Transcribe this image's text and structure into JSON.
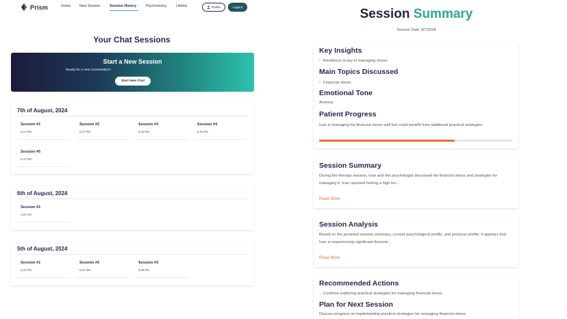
{
  "nav": {
    "brand": "Prism",
    "links": [
      "Home",
      "New Session",
      "Session History",
      "Psychometry",
      "Lifeline"
    ],
    "profile_label": "Profile",
    "logout_label": "Logout"
  },
  "left": {
    "title": "Your Chat Sessions",
    "banner": {
      "title": "Start a New Session",
      "subtitle": "Ready for a new conversation?",
      "button": "Start New Chat"
    },
    "days": [
      {
        "title": "7th of August, 2024",
        "sessions": [
          {
            "label": "Session #1",
            "time": "6:21 PM"
          },
          {
            "label": "Session #2",
            "time": "6:27 PM"
          },
          {
            "label": "Session #3",
            "time": "6:26 PM"
          },
          {
            "label": "Session #4",
            "time": "6:32 PM"
          },
          {
            "label": "Session #5",
            "time": "6:41 PM"
          }
        ]
      },
      {
        "title": "6th of August, 2024",
        "sessions": [
          {
            "label": "Session #1",
            "time": "1:03 AM"
          }
        ]
      },
      {
        "title": "5th of August, 2024",
        "sessions": [
          {
            "label": "Session #1",
            "time": "6:31 PM"
          },
          {
            "label": "Session #2",
            "time": "6:51 PM"
          },
          {
            "label": "Session #3",
            "time": "6:58 PM"
          }
        ]
      }
    ]
  },
  "right": {
    "title_part1": "Session ",
    "title_part2": "Summary",
    "date": "Session Date: 8/7/2024",
    "insights": {
      "key_insights_heading": "Key Insights",
      "key_insights_item": "Resilience is key in managing stress",
      "topics_heading": "Main Topics Discussed",
      "topics_item": "Financial stress",
      "tone_heading": "Emotional Tone",
      "tone_value": "Anxious",
      "progress_heading": "Patient Progress",
      "progress_text": "Ivan is managing his financial stress well but could benefit from additional practical strategies.",
      "progress_fraction": 0.7
    },
    "summary": {
      "heading": "Session Summary",
      "text": "During the therapy session, Ivan and the psychologist discussed his financial stress and strategies for managing it. Ivan reported feeling a high lev...",
      "link": "Read More"
    },
    "analysis": {
      "heading": "Session Analysis",
      "text": "Based on the provided session summary, current psychological profile, and previous profile, it appears that Ivan is experiencing significant financia...",
      "link": "Read More"
    },
    "actions": {
      "heading": "Recommended Actions",
      "arrow": "→",
      "item": "Continue exploring practical strategies for managing financial stress",
      "plan_heading": "Plan for Next Session",
      "plan_text": "Discuss progress on implementing practical strategies for managing financial stress."
    }
  },
  "colors": {
    "primary": "#2d2450",
    "accent_teal": "#2aa897",
    "accent_orange": "#e8743b",
    "logout_bg": "#1f5a63"
  }
}
